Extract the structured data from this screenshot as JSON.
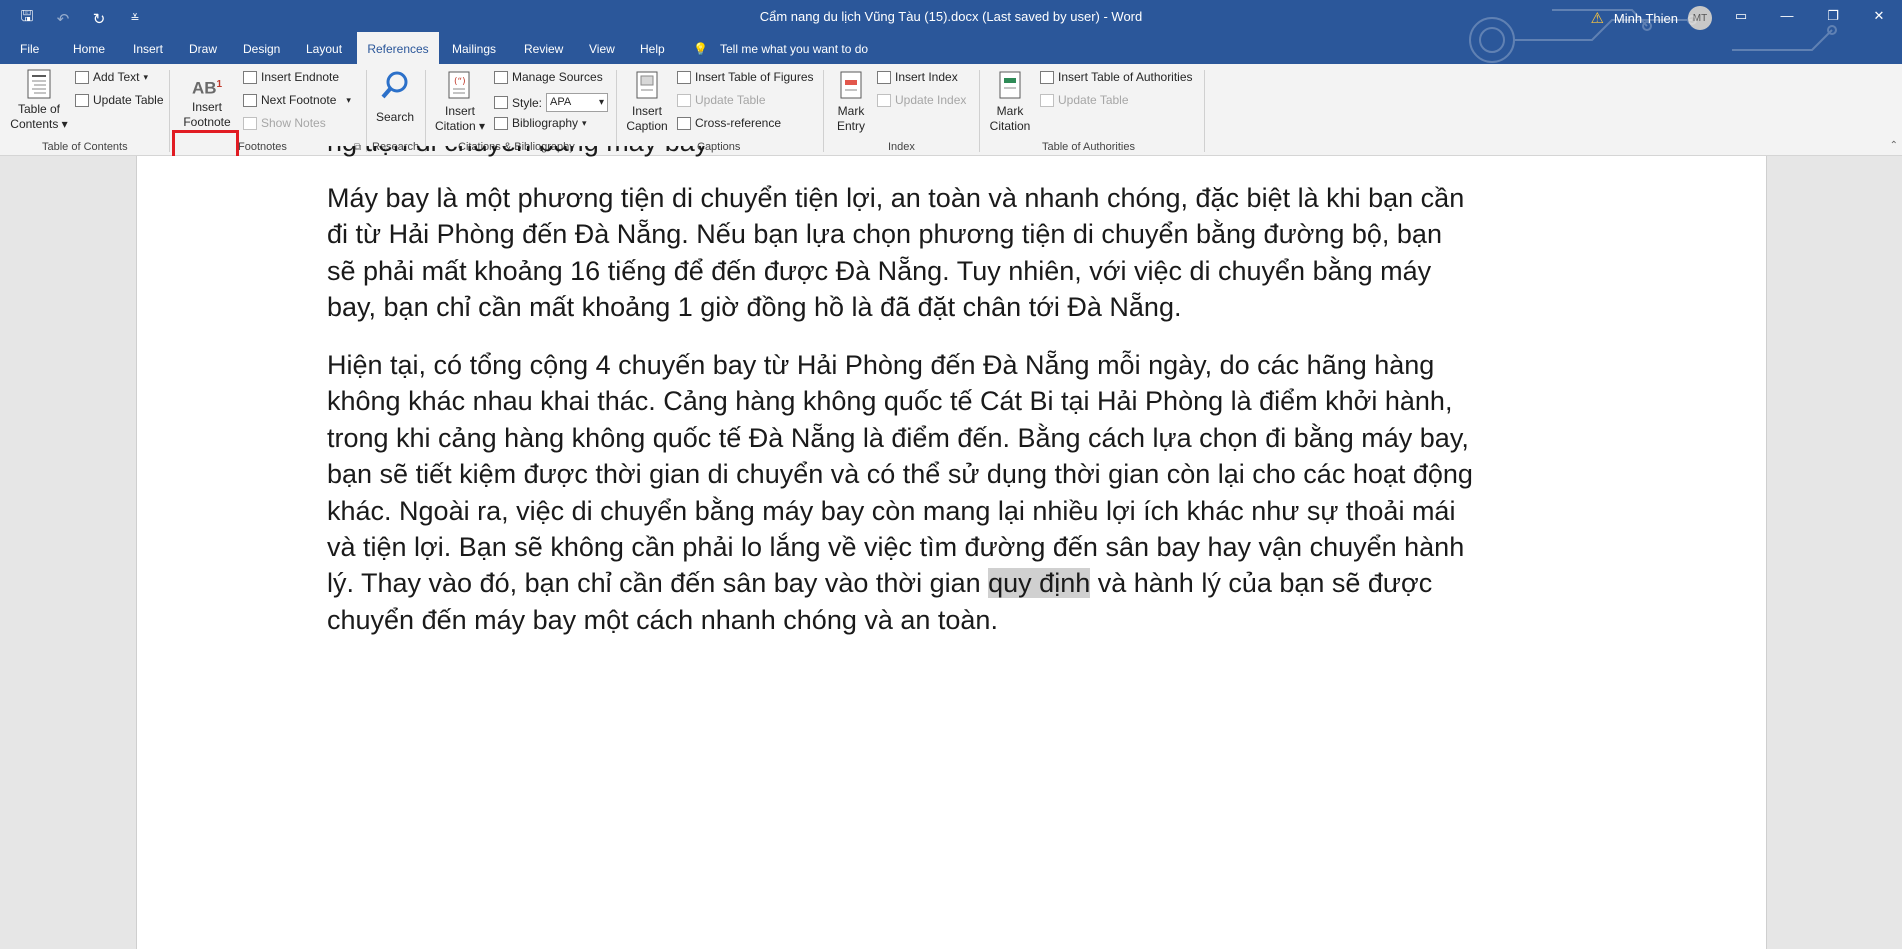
{
  "titlebar": {
    "title": "Cẩm nang du lịch Vũng Tàu (15).docx (Last saved by user)  -  Word",
    "user_name": "Minh Thien",
    "user_initials": "MT"
  },
  "tabs": [
    "File",
    "Home",
    "Insert",
    "Draw",
    "Design",
    "Layout",
    "References",
    "Mailings",
    "Review",
    "View",
    "Help"
  ],
  "active_tab": "References",
  "tell_me": "Tell me what you want to do",
  "ribbon": {
    "toc": {
      "btn_line1": "Table of",
      "btn_line2": "Contents",
      "add_text": "Add Text",
      "update_table": "Update Table",
      "group_label": "Table of Contents"
    },
    "footnotes": {
      "insert_footnote_line1": "Insert",
      "insert_footnote_line2": "Footnote",
      "icon_text": "AB",
      "icon_sup": "1",
      "insert_endnote": "Insert Endnote",
      "next_footnote": "Next Footnote",
      "show_notes": "Show Notes",
      "group_label": "Footnotes"
    },
    "research": {
      "search": "Search",
      "group_label": "Research"
    },
    "citations": {
      "insert_citation_line1": "Insert",
      "insert_citation_line2": "Citation",
      "manage_sources": "Manage Sources",
      "style_label": "Style:",
      "style_value": "APA",
      "bibliography": "Bibliography",
      "group_label": "Citations & Bibliography"
    },
    "captions": {
      "insert_caption_line1": "Insert",
      "insert_caption_line2": "Caption",
      "insert_table_of_figures": "Insert Table of Figures",
      "update_table": "Update Table",
      "cross_reference": "Cross-reference",
      "group_label": "Captions"
    },
    "index": {
      "mark_entry_line1": "Mark",
      "mark_entry_line2": "Entry",
      "insert_index": "Insert Index",
      "update_index": "Update Index",
      "group_label": "Index"
    },
    "authorities": {
      "mark_citation_line1": "Mark",
      "mark_citation_line2": "Citation",
      "insert_table_of_authorities": "Insert Table of Authorities",
      "update_table": "Update Table",
      "group_label": "Table of Authorities"
    }
  },
  "document": {
    "para1_lines": [
      "Máy bay là một phương tiện di chuyển tiện lợi, an toàn và nhanh chóng, đặc biệt là khi bạn cần",
      "đi từ Hải Phòng đến Đà Nẵng. Nếu bạn lựa chọn phương tiện di chuyển bằng đường bộ, bạn",
      "sẽ phải mất khoảng 16 tiếng để đến được Đà Nẵng. Tuy nhiên, với việc di chuyển bằng máy",
      "bay, bạn chỉ cần mất khoảng 1 giờ đồng hồ là đã đặt chân tới Đà Nẵng."
    ],
    "para2_lines": [
      "Hiện tại, có tổng cộng 4 chuyến bay từ Hải Phòng đến Đà Nẵng mỗi ngày, do các hãng hàng",
      "không khác nhau khai thác. Cảng hàng không quốc tế Cát Bi tại Hải Phòng là điểm khởi hành,",
      "trong khi cảng hàng không quốc tế Đà Nẵng là điểm đến. Bằng cách lựa chọn đi bằng máy bay,",
      "bạn sẽ tiết kiệm được thời gian di chuyển và có thể sử dụng thời gian còn lại cho các hoạt động",
      "khác. Ngoài ra, việc di chuyển bằng máy bay còn mang lại nhiều lợi ích khác như sự thoải mái",
      "và tiện lợi. Bạn sẽ không cần phải lo lắng về việc tìm đường đến sân bay hay vận chuyển hành"
    ],
    "para2_line7_before": "lý. Thay vào đó, bạn chỉ cần đến sân bay vào thời gian ",
    "para2_line7_highlight": "quy định",
    "para2_line7_after": " và hành lý của bạn sẽ được",
    "para2_line8": "chuyển đến máy bay một cách nhanh chóng và an toàn.",
    "cut_line": "ng tiện di chuyển bằng máy bay"
  },
  "colors": {
    "titlebar": "#2b579a",
    "ribbon": "#f3f3f3",
    "highlight_border": "#e11b22",
    "text_highlight": "#d0d0d0"
  }
}
